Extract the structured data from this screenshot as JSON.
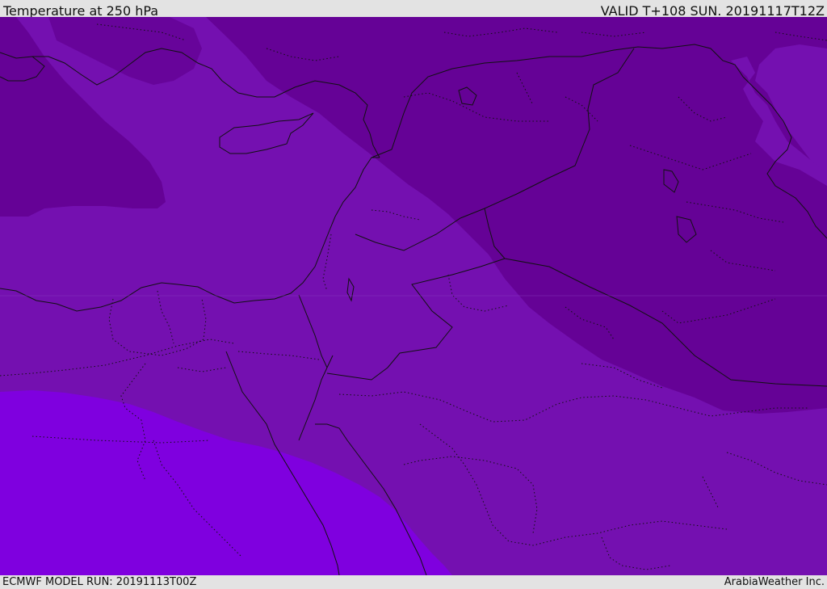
{
  "header": {
    "title": "Temperature at 250 hPa",
    "valid_time": "VALID T+108 SUN. 20191117T12Z"
  },
  "footer": {
    "model_run": "ECMWF MODEL RUN: 20191113T00Z",
    "credit": "ArabiaWeather Inc."
  },
  "map": {
    "region": "Eastern Mediterranean / Middle East",
    "colors": {
      "darkest_band": "#650296",
      "mid_band": "#7410b0",
      "light_band": "#7f00df",
      "border_line": "#111111"
    }
  }
}
